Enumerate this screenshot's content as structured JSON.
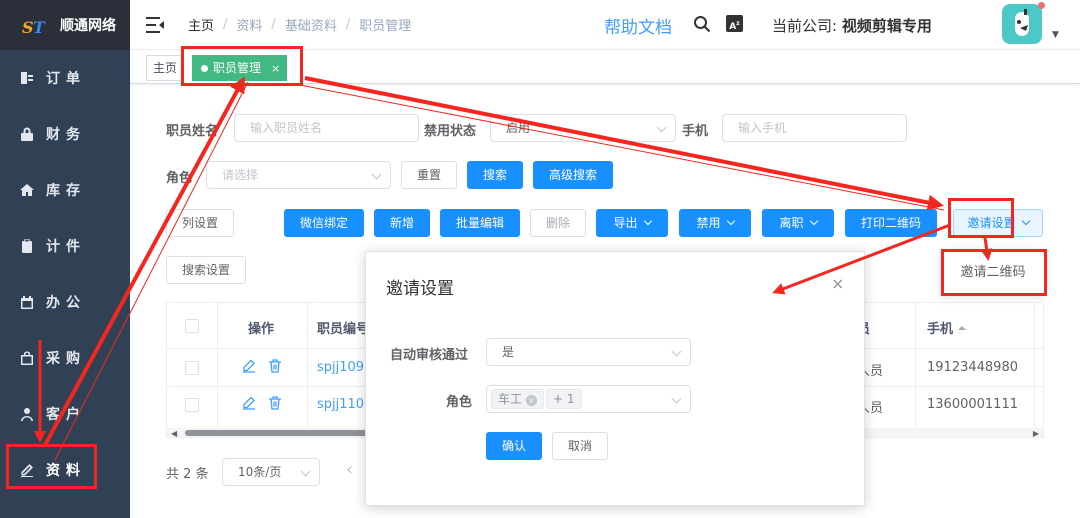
{
  "sidebar": {
    "logo_text": "顺通网络",
    "items": [
      {
        "label": "订单",
        "icon": "order-icon"
      },
      {
        "label": "财务",
        "icon": "lock-icon"
      },
      {
        "label": "库存",
        "icon": "home-icon"
      },
      {
        "label": "计件",
        "icon": "clipboard-icon"
      },
      {
        "label": "办公",
        "icon": "calendar-icon"
      },
      {
        "label": "采购",
        "icon": "bag-icon"
      },
      {
        "label": "客户",
        "icon": "user-icon"
      },
      {
        "label": "资料",
        "icon": "edit-icon"
      }
    ]
  },
  "header": {
    "breadcrumb": [
      "主页",
      "资料",
      "基础资料",
      "职员管理"
    ],
    "help_link": "帮助文档",
    "company_prefix": "当前公司:",
    "company_name": "视频剪辑专用"
  },
  "tags": {
    "home": "主页",
    "active": "职员管理",
    "close": "×"
  },
  "filters": {
    "name_label": "职员姓名",
    "name_placeholder": "输入职员姓名",
    "status_label": "禁用状态",
    "status_value": "启用",
    "phone_label": "手机",
    "phone_placeholder": "输入手机",
    "role_label": "角色",
    "role_placeholder": "请选择",
    "reset": "重置",
    "search": "搜索",
    "advanced": "高级搜索"
  },
  "toolbar": {
    "column_settings": "列设置",
    "wechat_bind": "微信绑定",
    "add": "新增",
    "batch_edit": "批量编辑",
    "delete": "删除",
    "export": "导出",
    "disable": "禁用",
    "resign": "离职",
    "print_qr": "打印二维码",
    "invite_settings": "邀请设置",
    "search_settings": "搜索设置"
  },
  "dropdown": {
    "invite_qr": "邀请二维码"
  },
  "table": {
    "columns": {
      "operation": "操作",
      "staff_no": "职员编号",
      "role_fragment": "员",
      "phone": "手机"
    },
    "rows": [
      {
        "staff_no": "spjj1095",
        "role_fragment": "人员",
        "phone": "19123448980"
      },
      {
        "staff_no": "spjj1107",
        "role_fragment": "人员",
        "phone": "13600001111"
      }
    ]
  },
  "pagination": {
    "total": "共 2 条",
    "page_size": "10条/页",
    "prev": "‹"
  },
  "modal": {
    "title": "邀请设置",
    "close": "×",
    "auto_approve_label": "自动审核通过",
    "auto_approve_value": "是",
    "role_label": "角色",
    "role_chip": "车工",
    "role_more": "+ 1",
    "confirm": "确认",
    "cancel": "取消"
  },
  "colors": {
    "sidebar_bg": "#304156",
    "primary": "#1890ff",
    "tag_active": "#42b983",
    "annotation_red": "#f5261f"
  }
}
